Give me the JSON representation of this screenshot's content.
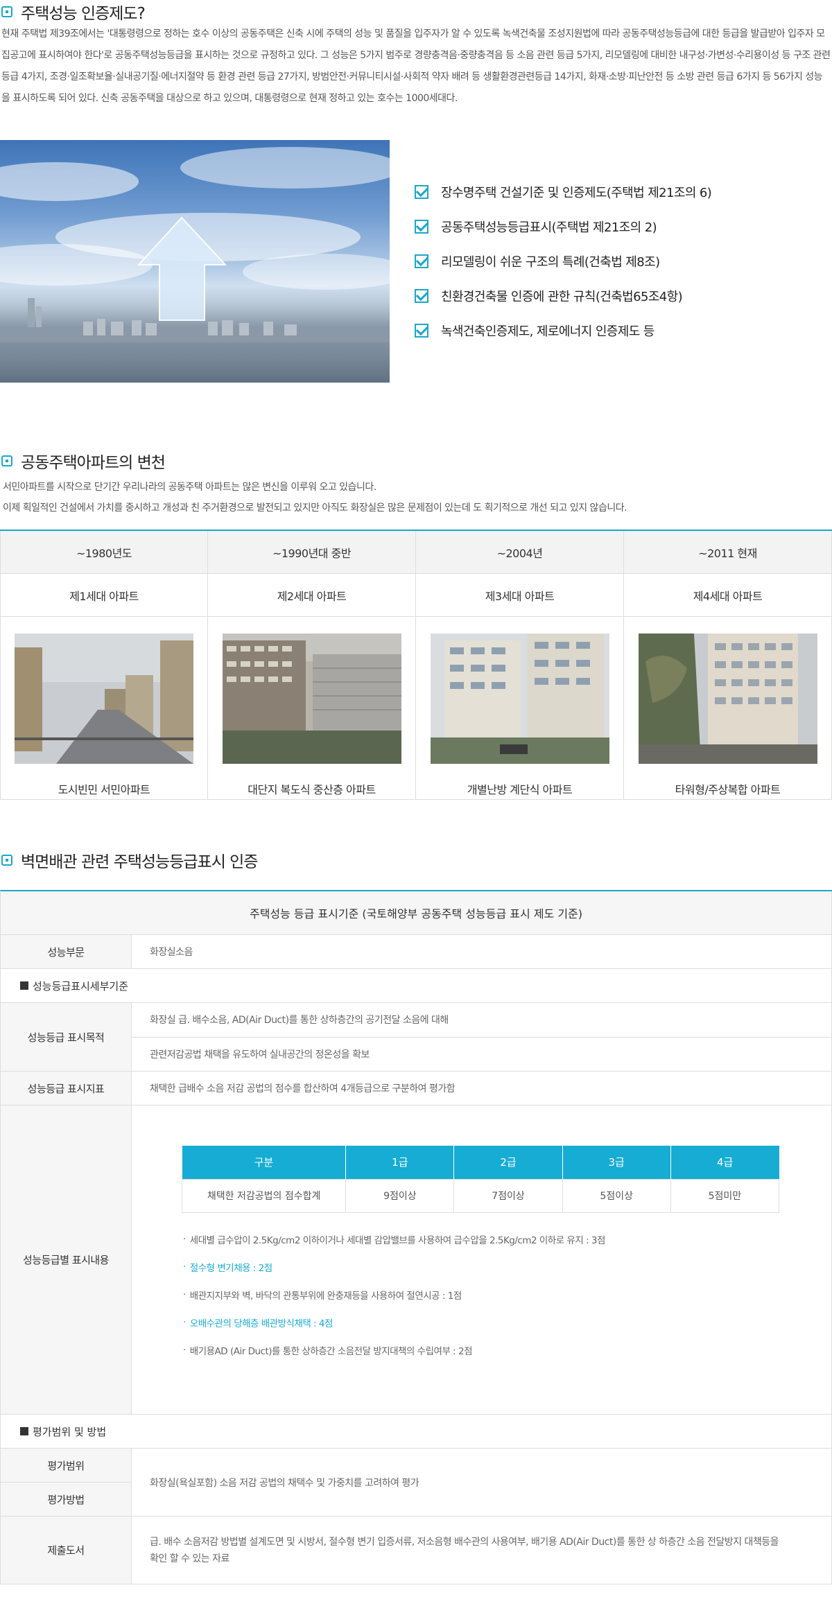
{
  "section1": {
    "title": "주택성능 인증제도?",
    "paragraph": "현재 주택법 제39조에서는 '대통령령으로 정하는 호수 이상의 공동주택은 신축 시에 주택의 성능 및 품질을 입주자가 알 수 있도록 녹색건축물 조성지원법에 따라 공동주택성능등급에 대한 등급을 발급받아 입주자 모집공고에 표시하여야 한다'로 공동주택성능등급을 표시하는 것으로 규정하고 있다. 그 성능은 5가지 범주로 경량충격음·중량충격음 등 소음 관련 등급 5가지, 리모델링에 대비한 내구성·가변성·수리용이성 등 구조 관련 등급 4가지, 조경·일조확보율·실내공기질·에너지절약 등 환경 관련 등급 27가지, 방범안전·커뮤니티시설·사회적 약자 배려 등 생활환경관련등급 14가지, 화재·소방·피난안전 등 소방 관련 등급 6가지 등 56가지 성능을 표시하도록 되어 있다. 신축 공동주택을 대상으로 하고 있으며, 대통령령으로 현재 정하고 있는 호수는 1000세대다.",
    "checklist": [
      "장수명주택 건설기준 및 인증제도(주택법 제21조의 6)",
      "공동주택성능등급표시(주택법 제21조의 2)",
      "리모델링이 쉬운 구조의 특례(건축법 제8조)",
      "친환경건축물 인증에 관한 규칙(건축법65조4항)",
      "녹색건축인증제도, 제로에너지 인증제도 등"
    ]
  },
  "section2": {
    "title": "공동주택아파트의 변천",
    "lines": [
      "서민아파트를 시작으로 단기간 우리나라의 공동주택 아파트는 많은 변신을 이루워 오고 있습니다.",
      "이제 획일적인 건설에서 가치를 중시하고 개성과 친 주거환경으로 발전되고 있지만 아직도 화장실은 많은 문제점이 있는데 도 획기적으로 개선 되고 있지 않습니다."
    ],
    "eras": [
      {
        "year": "~1980년도",
        "gen": "제1세대 아파트",
        "caption": "도시빈민 서민아파트"
      },
      {
        "year": "~1990년대 중반",
        "gen": "제2세대 아파트",
        "caption": "대단지 복도식 중산층 아파트"
      },
      {
        "year": "~2004년",
        "gen": "제3세대 아파트",
        "caption": "개별난방 계단식 아파트"
      },
      {
        "year": "~2011 현재",
        "gen": "제4세대 아파트",
        "caption": "타워형/주상복합 아파트"
      }
    ]
  },
  "section3": {
    "title": "벽면배관 관련 주택성능등급표시 인증",
    "table_header": "주택성능 등급 표시기준 (국토해양부 공동주택 성능등급 표시 제도 기준)",
    "row_performance": {
      "label": "성능부문",
      "value": "화장실소음"
    },
    "subhead1": "성능등급표시세부기준",
    "row_purpose": {
      "label": "성능등급 표시목적",
      "values": [
        "화장실 급. 배수소음, AD(Air Duct)를 통한 상하층간의 공기전달 소음에 대해",
        "관련저감공법 채택을 유도하여 실내공간의 정온성을 확보"
      ]
    },
    "row_index": {
      "label": "성능등급 표시지표",
      "value": "채택한 급배수 소음 저감 공법의 점수를 합산하여 4개등급으로 구분하여 평가함"
    },
    "row_content": {
      "label": "성능등급별 표시내용",
      "grade_headers": [
        "구분",
        "1급",
        "2급",
        "3급",
        "4급"
      ],
      "grade_row": [
        "채택한 저감공법의 점수합계",
        "9점이상",
        "7점이상",
        "5점이상",
        "5점미만"
      ],
      "notes": [
        {
          "text": "세대별 급수압이 2.5Kg/cm2 이하이거나 세대별 감압밸브를 사용하여 급수압을 2.5Kg/cm2 이하로 유지 : 3점",
          "highlight": false
        },
        {
          "text": "절수형 변기채용 : 2점",
          "highlight": true
        },
        {
          "text": "배관지지부와 벽, 바닥의 관통부위에 완충재등을 사용하여 절연시공 : 1점",
          "highlight": false
        },
        {
          "text": "오배수관의 당해층 배관방식채택 : 4점",
          "highlight": true
        },
        {
          "text": "배기용AD (Air Duct)를 통한 상하층간 소음전달 방지대책의 수립여부 : 2점",
          "highlight": false
        }
      ]
    },
    "subhead2": "평가범위 및 방법",
    "row_scope": {
      "label1": "평가범위",
      "label2": "평가방법",
      "value": "화장실(욕실포함) 소음 저감 공법의 채택수 및 가중치를 고려하여 평가"
    },
    "row_docs": {
      "label": "제출도서",
      "value": "급. 배수 소음저감 방법별 설계도면 및 시방서, 절수형 변기 입증서류, 저소음형 배수관의 사용여부, 배기용 AD(Air Duct)를 통한 상 하층간 소음 전달방지 대책등을 확인 할 수 있는 자료"
    }
  },
  "colors": {
    "accent": "#1aa7c9",
    "table_header": "#17acd3"
  },
  "icons": [
    "section-bullet-icon",
    "checkbox-checked-icon"
  ]
}
